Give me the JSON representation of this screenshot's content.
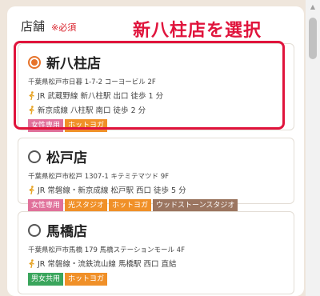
{
  "form": {
    "label": "店舗",
    "required": "※必須"
  },
  "callout": "新八柱店を選択",
  "colors": {
    "accent_red": "#e0143c",
    "radio_orange": "#e6732b",
    "tag_pink": "#e0709a",
    "tag_orange": "#f09028",
    "tag_green": "#3aa55c",
    "tag_brown": "#9b7560"
  },
  "stores": [
    {
      "name": "新八柱店",
      "selected": true,
      "address": "千葉県松戸市日暮 1-7-2 コーヨービル 2F",
      "access": [
        "JR 武蔵野線 新八柱駅 出口 徒歩 1 分",
        "新京成線 八柱駅 南口 徒歩 2 分"
      ],
      "tags": [
        "女性専用",
        "ホットヨガ"
      ]
    },
    {
      "name": "松戸店",
      "selected": false,
      "address": "千葉県松戸市松戸 1307-1 キテミテマツド 9F",
      "access": [
        "JR 常磐線・新京成線 松戸駅 西口 徒歩 5 分"
      ],
      "tags": [
        "女性専用",
        "光スタジオ",
        "ホットヨガ",
        "ウッドストーンスタジオ"
      ]
    },
    {
      "name": "馬橋店",
      "selected": false,
      "address": "千葉県松戸市馬橋 179 馬橋ステーションモール 4F",
      "access": [
        "JR 常磐線・流鉄流山線 馬橋駅 西口 直結"
      ],
      "tags": [
        "男女共用",
        "ホットヨガ"
      ]
    }
  ],
  "icons": {
    "walk": "walking-person-icon",
    "scroll_up": "chevron-up-icon"
  }
}
